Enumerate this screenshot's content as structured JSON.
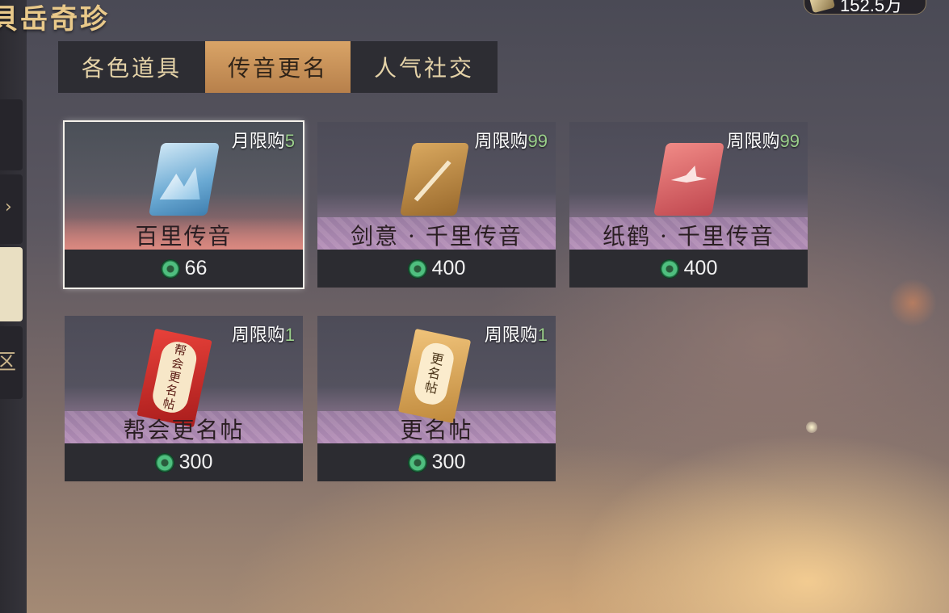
{
  "header": {
    "title": "貝岳奇珍",
    "currency_value": "152.5万"
  },
  "tabs": [
    {
      "label": "各色道具",
      "selected": false
    },
    {
      "label": "传音更名",
      "selected": true
    },
    {
      "label": "人气社交",
      "selected": false
    }
  ],
  "sidebar": {
    "chevron": "›",
    "glyph": "区"
  },
  "items": [
    {
      "name": "百里传音",
      "limit_label": "月限购",
      "limit_count": "5",
      "price": "66",
      "icon": "blue-scroll-icon",
      "selected": true
    },
    {
      "name": "剑意 · 千里传音",
      "limit_label": "周限购",
      "limit_count": "99",
      "price": "400",
      "icon": "sword-scroll-icon",
      "selected": false
    },
    {
      "name": "纸鹤 · 千里传音",
      "limit_label": "周限购",
      "limit_count": "99",
      "price": "400",
      "icon": "paper-crane-scroll-icon",
      "selected": false
    },
    {
      "name": "帮会更名帖",
      "limit_label": "周限购",
      "limit_count": "1",
      "price": "300",
      "icon": "guild-rename-card-icon",
      "card_text": [
        "帮",
        "会",
        "更",
        "名",
        "帖"
      ],
      "selected": false
    },
    {
      "name": "更名帖",
      "limit_label": "周限购",
      "limit_count": "1",
      "price": "300",
      "icon": "rename-card-icon",
      "card_text": [
        "更",
        "名",
        "帖"
      ],
      "selected": false
    }
  ],
  "currency_icon": "jade-coin-icon",
  "colors": {
    "tab_active": "#d9a467",
    "limit_count": "#9bd08b",
    "price_bar": "#2c2c31"
  }
}
